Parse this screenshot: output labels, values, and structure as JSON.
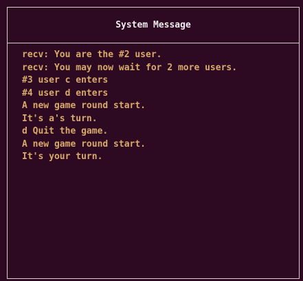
{
  "panel": {
    "title": "System Message",
    "messages": [
      "recv: You are the #2 user.",
      "recv: You may now wait for 2 more users.",
      "#3 user c enters",
      "#4 user d enters",
      "A new game round start.",
      "It's a's turn.",
      "d Quit the game.",
      "A new game round start.",
      "It's your turn."
    ]
  },
  "colors": {
    "background": "#2d0a22",
    "border": "#d8cfd6",
    "title_text": "#f2ecf0",
    "message_text": "#d9a96a"
  }
}
